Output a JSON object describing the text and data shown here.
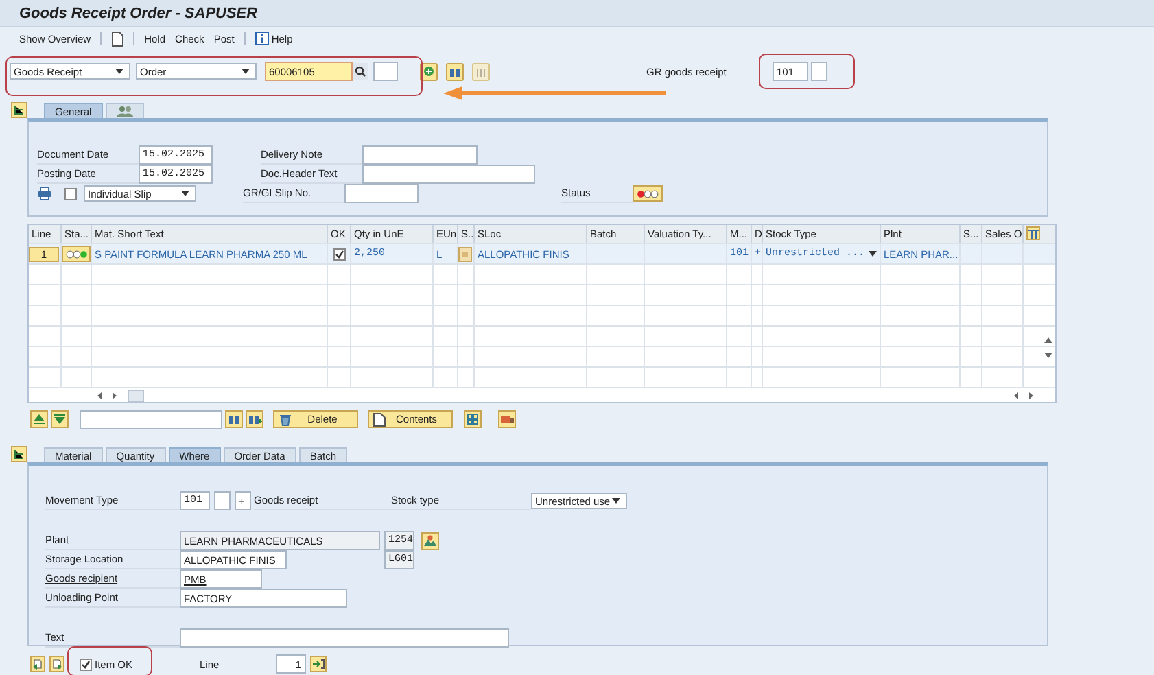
{
  "window": {
    "title": "Goods Receipt Order - SAPUSER"
  },
  "toolbar": {
    "overview": "Show Overview",
    "buttons": [
      "Hold",
      "Check",
      "Post"
    ],
    "help": "Help"
  },
  "selection": {
    "transaction": "Goods Receipt",
    "reference": "Order",
    "order_number": "60006105",
    "gr_label": "GR goods receipt",
    "movement_type": "101",
    "highlighted": true,
    "gr_highlighted": true,
    "callout_arrow": true
  },
  "header": {
    "tabs": [
      {
        "kind": "text",
        "label": "General",
        "selected": true
      },
      {
        "kind": "icon",
        "selected": false
      }
    ],
    "document_date": {
      "label": "Document Date",
      "value": "15.02.2025"
    },
    "posting_date": {
      "label": "Posting Date",
      "value": "15.02.2025"
    },
    "print": {
      "checked": false,
      "slip": "Individual Slip"
    },
    "delivery_note": {
      "label": "Delivery Note"
    },
    "header_text": {
      "label": "Doc.Header Text"
    },
    "slip_no": {
      "label": "GR/GI Slip No."
    },
    "status": {
      "label": "Status",
      "color": "#e0262b"
    }
  },
  "items_table": {
    "columns": [
      "Line",
      "Sta...",
      "Mat. Short Text",
      "OK",
      "Qty in UnE",
      "EUn",
      "S..",
      "SLoc",
      "Batch",
      "Valuation Ty...",
      "M...",
      "D",
      "Stock Type",
      "Plnt",
      "S...",
      "Sales O"
    ],
    "rows": [
      {
        "line": "1",
        "color": "#2fb82f",
        "text": "S PAINT FORMULA LEARN PHARMA 250 ML",
        "ok": true,
        "qty": "2,250",
        "unit": "L",
        "sloc": "ALLOPATHIC FINIS",
        "movement": "101",
        "debit": "+",
        "stock_type": "Unrestricted ...",
        "plant": "LEARN PHAR..."
      }
    ]
  },
  "table_toolbar": {
    "delete": "Delete",
    "contents": "Contents"
  },
  "detail": {
    "tabs": [
      {
        "label": "Material",
        "selected": false
      },
      {
        "label": "Quantity",
        "selected": false
      },
      {
        "label": "Where",
        "selected": true
      },
      {
        "label": "Order Data",
        "selected": false
      },
      {
        "label": "Batch",
        "selected": false
      }
    ],
    "movement_type": {
      "label": "Movement Type",
      "value": "101",
      "debit": "+",
      "text": "Goods receipt"
    },
    "stock_type": {
      "label": "Stock type",
      "value": "Unrestricted use"
    },
    "plant": {
      "label": "Plant",
      "value": "LEARN PHARMACEUTICALS",
      "code": "1254"
    },
    "storage_location": {
      "label": "Storage Location",
      "value": "ALLOPATHIC FINIS",
      "code": "LG01"
    },
    "goods_recipient": {
      "label": "Goods recipient",
      "value": "PMB"
    },
    "unloading_point": {
      "label": "Unloading Point",
      "value": "FACTORY"
    },
    "text": {
      "label": "Text"
    }
  },
  "footer": {
    "item_ok": {
      "label": "Item OK",
      "checked": true,
      "highlighted": true
    },
    "line_label": "Line",
    "line": "1"
  }
}
